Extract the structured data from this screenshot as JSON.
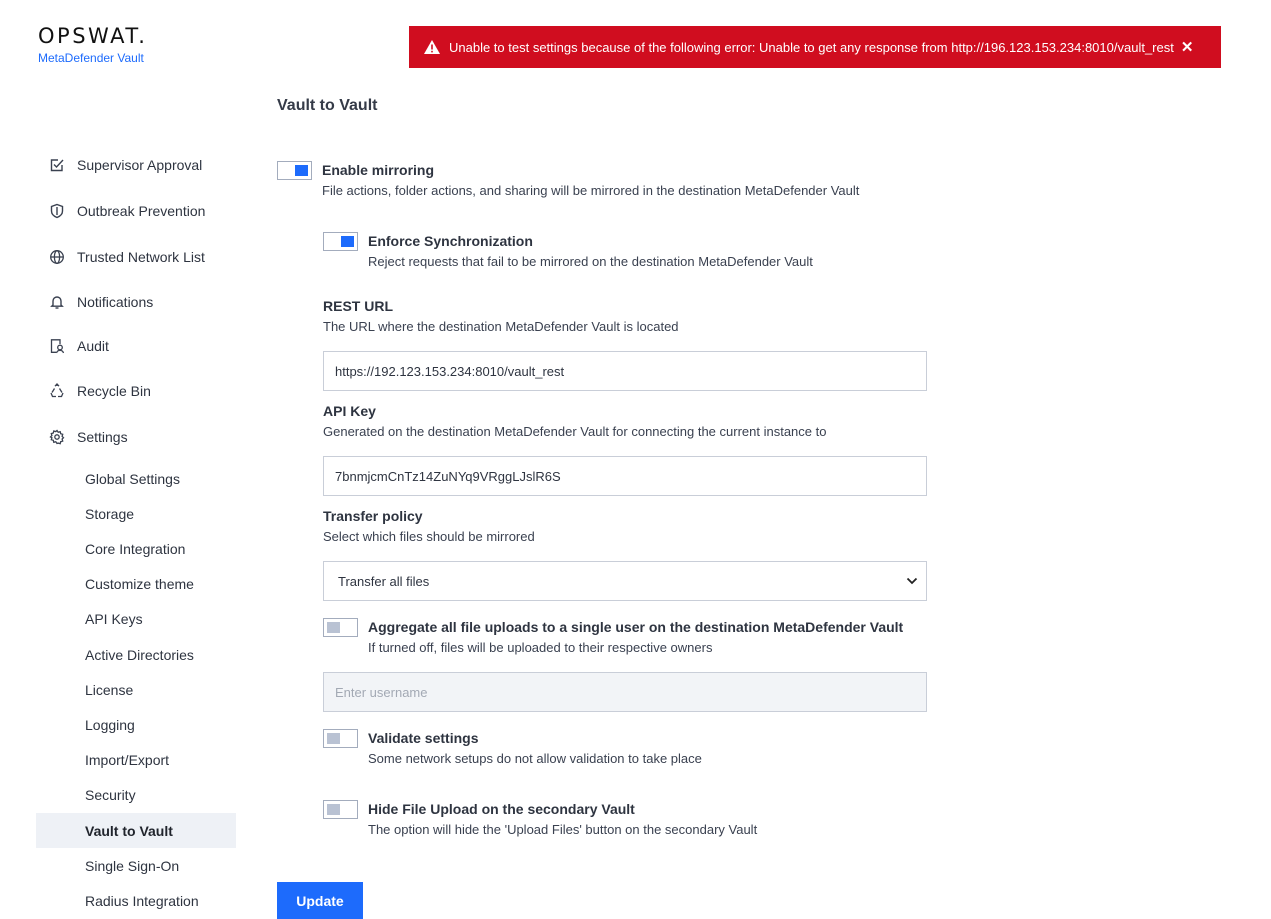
{
  "brand": {
    "logo": "OPSWAT.",
    "product": "MetaDefender Vault"
  },
  "error_banner": {
    "message": "Unable to test settings because of the following error: Unable to get any response from http://196.123.153.234:8010/vault_rest",
    "close_symbol": "✕",
    "color": "#d00d1f"
  },
  "sidebar": {
    "items": [
      {
        "label": "Supervisor Approval",
        "icon": "approval-check-icon"
      },
      {
        "label": "Outbreak Prevention",
        "icon": "shield-icon"
      },
      {
        "label": "Trusted Network List",
        "icon": "globe-icon"
      },
      {
        "label": "Notifications",
        "icon": "bell-icon"
      },
      {
        "label": "Audit",
        "icon": "audit-icon"
      },
      {
        "label": "Recycle Bin",
        "icon": "recycle-icon"
      },
      {
        "label": "Settings",
        "icon": "gear-icon"
      }
    ],
    "settings_items": [
      {
        "label": "Global Settings"
      },
      {
        "label": "Storage"
      },
      {
        "label": "Core Integration"
      },
      {
        "label": "Customize theme"
      },
      {
        "label": "API Keys"
      },
      {
        "label": "Active Directories"
      },
      {
        "label": "License"
      },
      {
        "label": "Logging"
      },
      {
        "label": "Import/Export"
      },
      {
        "label": "Security"
      },
      {
        "label": "Vault to Vault",
        "active": true
      },
      {
        "label": "Single Sign-On"
      },
      {
        "label": "Radius Integration"
      }
    ]
  },
  "page": {
    "title": "Vault to Vault",
    "enable_mirroring": {
      "title": "Enable mirroring",
      "desc": "File actions, folder actions, and sharing will be mirrored in the destination MetaDefender Vault",
      "on": true
    },
    "enforce_sync": {
      "title": "Enforce Synchronization",
      "desc": "Reject requests that fail to be mirrored on the destination MetaDefender Vault",
      "on": true
    },
    "rest_url": {
      "label": "REST URL",
      "desc": "The URL where the destination MetaDefender Vault is located",
      "value": "https://192.123.153.234:8010/vault_rest"
    },
    "api_key": {
      "label": "API Key",
      "desc": "Generated on the destination MetaDefender Vault for connecting the current instance to",
      "value": "7bnmjcmCnTz14ZuNYq9VRggLJslR6S"
    },
    "transfer_policy": {
      "label": "Transfer policy",
      "desc": "Select which files should be mirrored",
      "selected": "Transfer all files"
    },
    "aggregate": {
      "title": "Aggregate all file uploads to a single user on the destination MetaDefender Vault",
      "desc": "If turned off, files will be uploaded to their respective owners",
      "on": false
    },
    "username": {
      "placeholder": "Enter username"
    },
    "validate": {
      "title": "Validate settings",
      "desc": "Some network setups do not allow validation to take place",
      "on": false
    },
    "hide_upload": {
      "title": "Hide File Upload on the secondary Vault",
      "desc": "The option will hide the 'Upload Files' button on the secondary Vault",
      "on": false
    },
    "update_label": "Update"
  },
  "colors": {
    "accent": "#1d6bfc",
    "toggle_off": "#b9c2d3",
    "active_bg": "#eef1f6"
  }
}
